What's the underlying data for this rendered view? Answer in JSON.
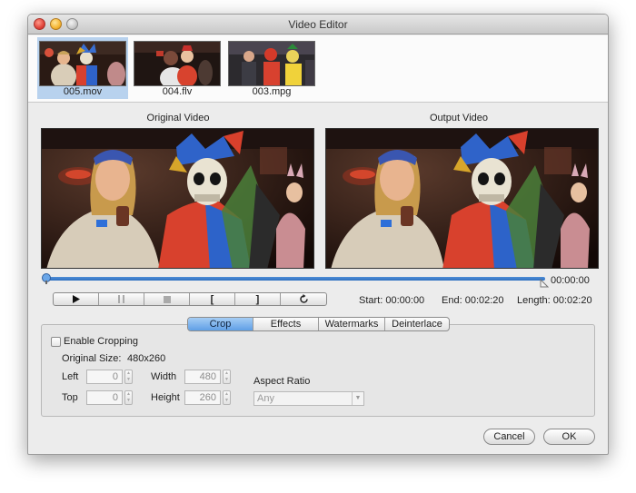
{
  "window": {
    "title": "Video Editor"
  },
  "thumbnails": [
    {
      "caption": "005.mov",
      "selected": true
    },
    {
      "caption": "004.flv",
      "selected": false
    },
    {
      "caption": "003.mpg",
      "selected": false
    }
  ],
  "preview": {
    "original_label": "Original Video",
    "output_label": "Output Video"
  },
  "timeline": {
    "current_time": "00:00:00",
    "position_fraction": 0.0
  },
  "controls": {
    "play_icon": "play-icon",
    "pause_icon": "pause-icon",
    "stop_icon": "stop-icon",
    "mark_in_label": "[",
    "mark_out_label": "]",
    "reset_icon": "reset-icon"
  },
  "times": {
    "start_label": "Start:",
    "start_value": "00:00:00",
    "end_label": "End:",
    "end_value": "00:02:20",
    "length_label": "Length:",
    "length_value": "00:02:20"
  },
  "tabs": [
    {
      "label": "Crop",
      "active": true
    },
    {
      "label": "Effects",
      "active": false
    },
    {
      "label": "Watermarks",
      "active": false
    },
    {
      "label": "Deinterlace",
      "active": false
    }
  ],
  "crop": {
    "enable_label": "Enable Cropping",
    "enabled": false,
    "original_size_label": "Original Size:",
    "original_size_value": "480x260",
    "left_label": "Left",
    "left_value": "0",
    "top_label": "Top",
    "top_value": "0",
    "width_label": "Width",
    "width_value": "480",
    "height_label": "Height",
    "height_value": "260",
    "aspect_ratio_label": "Aspect Ratio",
    "aspect_ratio_value": "Any"
  },
  "buttons": {
    "cancel": "Cancel",
    "ok": "OK"
  },
  "colors": {
    "accent": "#5f9fe6",
    "selection": "#b8d2ee",
    "window_bg": "#ececec"
  }
}
